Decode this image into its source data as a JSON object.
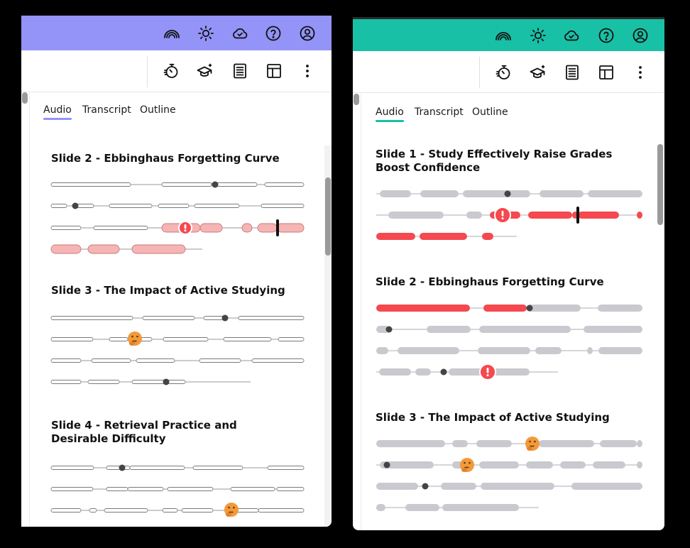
{
  "colors": {
    "left_accent": "#9393f8",
    "right_accent": "#18c0a6",
    "light_error_fill": "#f6b5b5",
    "error_red": "#f5484f",
    "gray_segment": "#c9c9cf",
    "marker": "#444444",
    "emoji": "#f29a3a"
  },
  "icons": {
    "topbar": [
      "rainbow-icon",
      "sun-icon",
      "cloud-check-icon",
      "help-icon",
      "account-icon"
    ],
    "toolbar": [
      "timer-icon",
      "graduation-cap-icon",
      "document-icon",
      "layout-icon",
      "more-vertical-icon"
    ],
    "waveform_markers": [
      "error-icon",
      "thinking-face-icon"
    ]
  },
  "left_panel": {
    "tabs": [
      {
        "label": "Audio",
        "active": true
      },
      {
        "label": "Transcript",
        "active": false
      },
      {
        "label": "Outline",
        "active": false
      }
    ],
    "slides": [
      {
        "title": "Slide 2 - Ebbinghaus Forgetting Curve"
      },
      {
        "title": "Slide 3 - The Impact of Active Studying"
      },
      {
        "title": "Slide 4 -  Retrieval Practice and Desirable Difficulty"
      }
    ]
  },
  "right_panel": {
    "tabs": [
      {
        "label": "Audio",
        "active": true
      },
      {
        "label": "Transcript",
        "active": false
      },
      {
        "label": "Outline",
        "active": false
      }
    ],
    "slides": [
      {
        "title": "Slide 1 - Study Effectively Raise Grades Boost Confidence"
      },
      {
        "title": "Slide 2 - Ebbinghaus Forgetting Curve"
      },
      {
        "title": "Slide 3 - The Impact of Active Studying"
      }
    ]
  }
}
